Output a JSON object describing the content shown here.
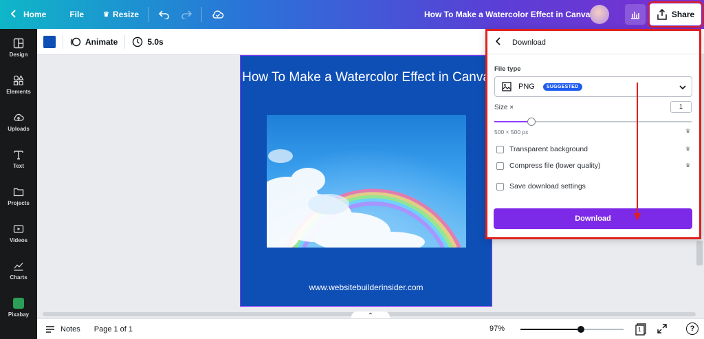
{
  "topbar": {
    "home": "Home",
    "file": "File",
    "resize": "Resize",
    "title": "How To Make a Watercolor Effect in Canva",
    "share": "Share"
  },
  "sidebar": {
    "items": [
      {
        "label": "Design",
        "icon": "design-icon"
      },
      {
        "label": "Elements",
        "icon": "elements-icon"
      },
      {
        "label": "Uploads",
        "icon": "upload-icon"
      },
      {
        "label": "Text",
        "icon": "text-icon"
      },
      {
        "label": "Projects",
        "icon": "folder-icon"
      },
      {
        "label": "Videos",
        "icon": "video-icon"
      },
      {
        "label": "Charts",
        "icon": "chart-icon"
      },
      {
        "label": "Pixabay",
        "icon": "pixabay-icon"
      }
    ]
  },
  "toolbar": {
    "color": "#0e4fb5",
    "animate": "Animate",
    "duration": "5.0s"
  },
  "design": {
    "title": "How To Make a Watercolor Effect in Canva",
    "url": "www.websitebuilderinsider.com"
  },
  "download_panel": {
    "header": "Download",
    "file_type_label": "File type",
    "file_type_value": "PNG",
    "badge": "SUGGESTED",
    "size_label": "Size ×",
    "size_value": "1",
    "slider_fraction": 0.19,
    "dimensions": "500 × 500 px",
    "options": [
      {
        "label": "Transparent background",
        "checked": false,
        "premium": true
      },
      {
        "label": "Compress file (lower quality)",
        "checked": false,
        "premium": true
      },
      {
        "label": "Save download settings",
        "checked": false,
        "premium": false
      }
    ],
    "button": "Download"
  },
  "bottombar": {
    "notes": "Notes",
    "page": "Page 1 of 1",
    "zoom": "97%",
    "zoom_fraction": 0.59,
    "page_count_badge": "1",
    "help": "?"
  },
  "colors": {
    "accent": "#8b3dff",
    "download_button": "#7d2ae8",
    "highlight": "#e0201e",
    "design_bg": "#0e4fb5",
    "sidebar_bg": "#18191b"
  }
}
